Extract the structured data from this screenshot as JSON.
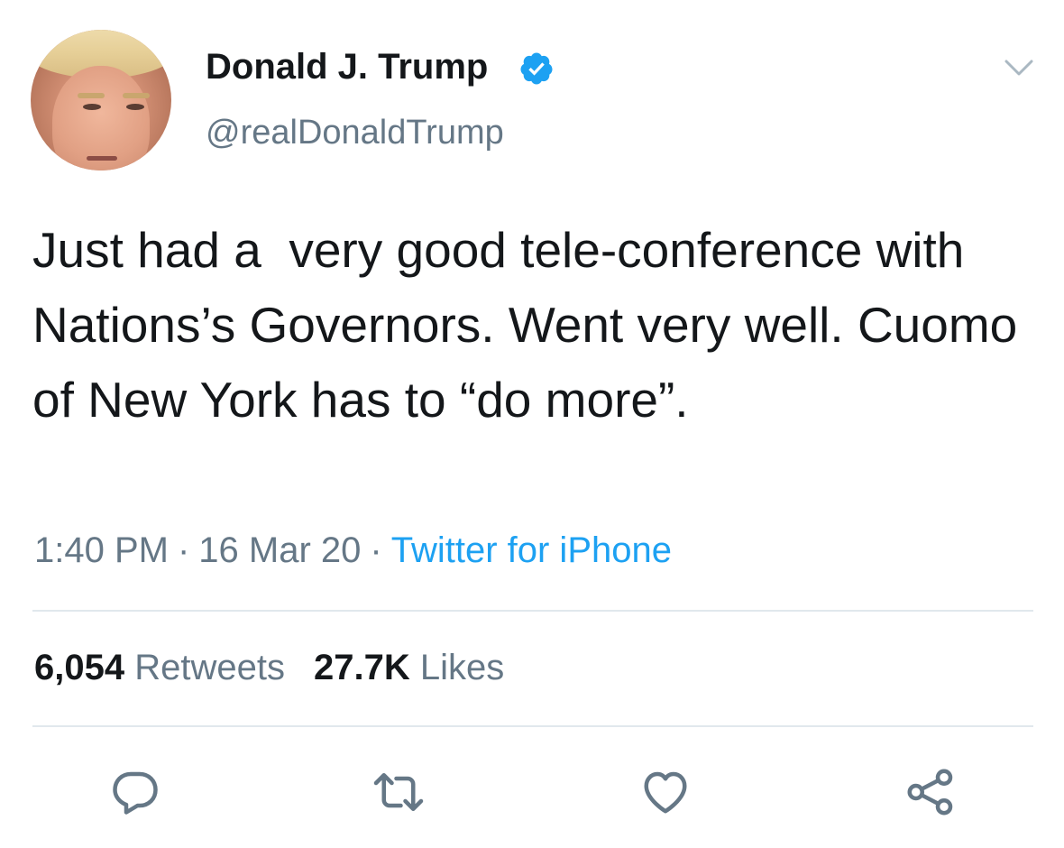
{
  "author": {
    "display_name": "Donald J. Trump",
    "handle": "@realDonaldTrump",
    "verified": true
  },
  "tweet": {
    "text": "Just had a  very good tele-conference with Nations’s Governors. Went very well. Cuomo of New York has to “do more”.",
    "time": "1:40 PM",
    "date": "16 Mar 20",
    "source": "Twitter for iPhone",
    "separator": "·"
  },
  "stats": {
    "retweets_count": "6,054",
    "retweets_label": "Retweets",
    "likes_count": "27.7K",
    "likes_label": "Likes"
  },
  "icons": {
    "avatar": "profile-photo",
    "verified": "verified-badge-icon",
    "menu": "chevron-down-icon",
    "reply": "reply-icon",
    "retweet": "retweet-icon",
    "like": "heart-icon",
    "share": "share-icon"
  },
  "colors": {
    "text": "#14171a",
    "secondary": "#657786",
    "accent": "#1da1f2",
    "divider": "#e1e8ed"
  }
}
